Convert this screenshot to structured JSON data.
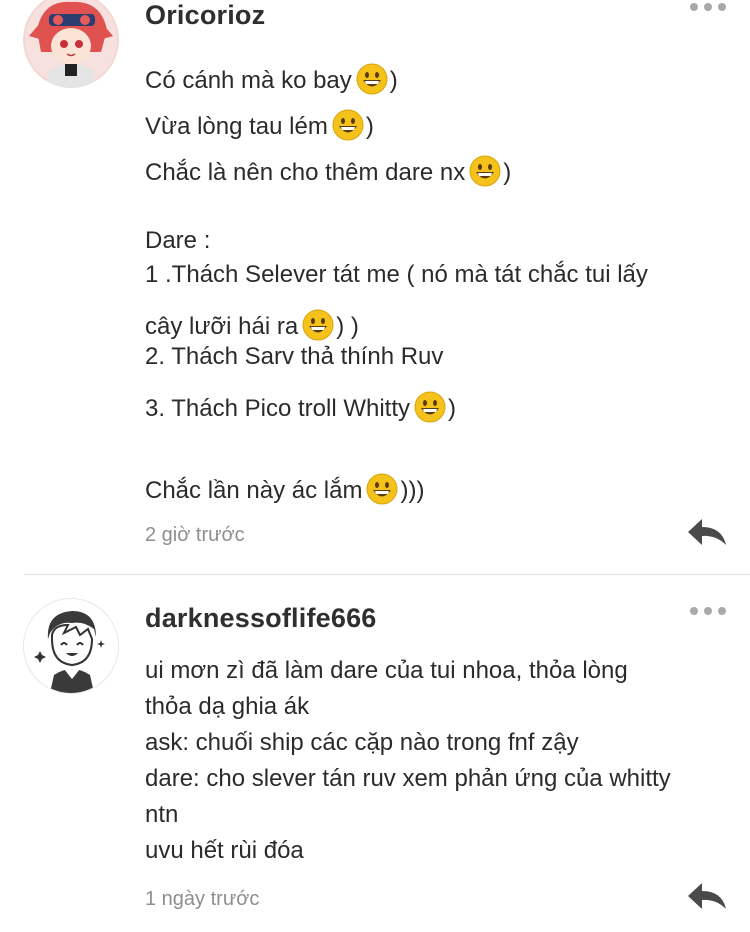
{
  "comments": [
    {
      "username": "Oricorioz",
      "lines": [
        {
          "text": "Có cánh mà ko bay",
          "emoji": true,
          "after": ")"
        },
        {
          "text": "Vừa lòng tau lém",
          "emoji": true,
          "after": ")"
        },
        {
          "text": "Chắc là nên cho thêm dare nx",
          "emoji": true,
          "after": ")"
        },
        {
          "text": "Dare :",
          "emoji": false,
          "after": ""
        },
        {
          "text": "1 .Thách Selever tát me ( nó mà tát chắc tui lấy",
          "emoji": false,
          "after": ""
        },
        {
          "text": "cây lưỡi hái ra",
          "emoji": true,
          "after": ") )"
        },
        {
          "text": "2. Thách Sarv thả thính  Ruv",
          "emoji": false,
          "after": ""
        },
        {
          "text": "3. Thách Pico troll Whitty",
          "emoji": true,
          "after": ")"
        },
        {
          "text": "Chắc lần này ác lắm",
          "emoji": true,
          "after": ")))"
        }
      ],
      "time": "2 giờ trước"
    },
    {
      "username": "darknessoflife666",
      "lines": [
        {
          "text": "ui mơn zì đã làm dare của tui nhoa, thỏa lòng",
          "emoji": false,
          "after": ""
        },
        {
          "text": "thỏa dạ ghia ák",
          "emoji": false,
          "after": ""
        },
        {
          "text": "ask: chuối ship các cặp nào trong fnf zậy",
          "emoji": false,
          "after": ""
        },
        {
          "text": "dare: cho slever tán ruv xem phản ứng của whitty",
          "emoji": false,
          "after": ""
        },
        {
          "text": "ntn",
          "emoji": false,
          "after": ""
        },
        {
          "text": "uvu hết rùi đóa",
          "emoji": false,
          "after": ""
        }
      ],
      "time": "1 ngày trước"
    }
  ],
  "icons": {
    "more": "more-dots-icon",
    "reply": "reply-arrow-icon",
    "emoji": "grinning-face-icon"
  },
  "colors": {
    "text": "#2b2b2b",
    "meta": "#8e8e8e",
    "icon": "#4a4a4a",
    "emoji": "#f5c21b"
  }
}
